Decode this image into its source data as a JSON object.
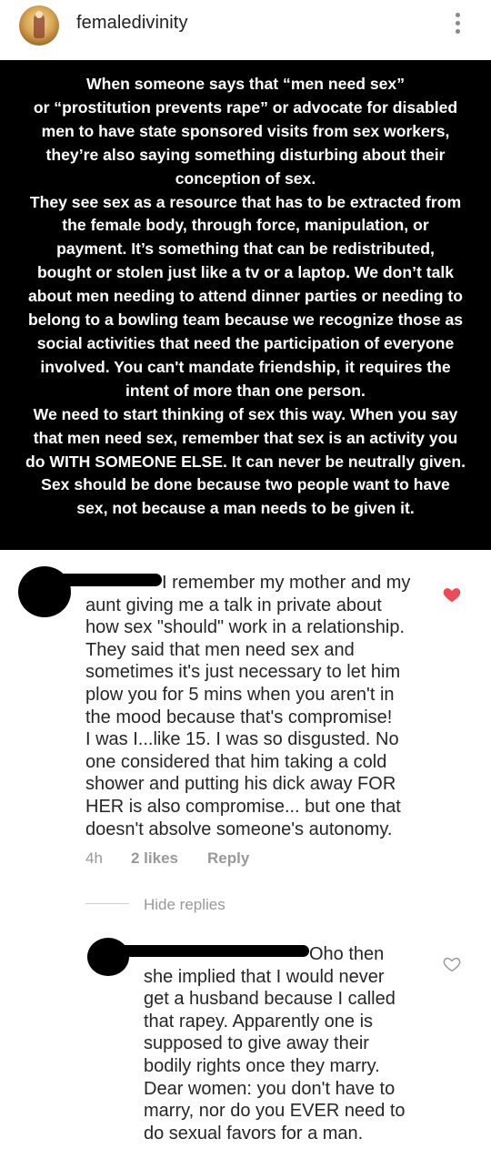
{
  "header": {
    "username": "femaledivinity",
    "menu_icon": "more-vertical-icon"
  },
  "post": {
    "text": "When someone says that “men need sex”\nor “prostitution prevents rape” or advocate for disabled\nmen to have state sponsored visits from sex workers,\nthey’re also saying something disturbing about their\nconception of sex.\nThey see sex as a resource that has to be extracted from\nthe female body, through force, manipulation, or\npayment. It’s something that can be redistributed,\nbought or stolen just like a tv or a laptop. We don’t talk\nabout men needing to attend dinner parties or needing to\nbelong to a bowling team because we recognize those as\nsocial activities that need the participation of everyone\ninvolved. You can't mandate friendship, it requires the\nintent of more than one person.\nWe need to start thinking of sex this way. When you say\nthat men need sex, remember that sex is an activity you\ndo WITH SOMEONE ELSE.  It can never be neutrally given.\nSex should be done because two people want to have\nsex, not because a man needs to be given it."
  },
  "comments": [
    {
      "text": "I remember my mother and my\naunt giving me a talk in private about\nhow sex \"should\" work in a relationship.\nThey said that men need sex and\nsometimes it's just necessary to let him\nplow you for 5 mins when you aren't in\nthe mood because that's compromise!\nI was I...like 15. I was so disgusted. No\none considered that him taking a cold\nshower and putting his dick away FOR\nHER is also compromise... but one that\ndoesn't absolve someone's autonomy.",
      "time": "4h",
      "likes": "2 likes",
      "reply_label": "Reply",
      "liked": true,
      "heart_color": "#ed4956"
    }
  ],
  "hide_replies_label": "Hide replies",
  "replies": [
    {
      "text": "Oho then\nshe implied that I would never\nget a husband because I called\nthat rapey. Apparently one is\nsupposed to give away their\nbodily rights once they marry.\nDear women: you don't have to\nmarry, nor do you EVER need to\ndo sexual favors for a man.",
      "liked": false
    }
  ]
}
